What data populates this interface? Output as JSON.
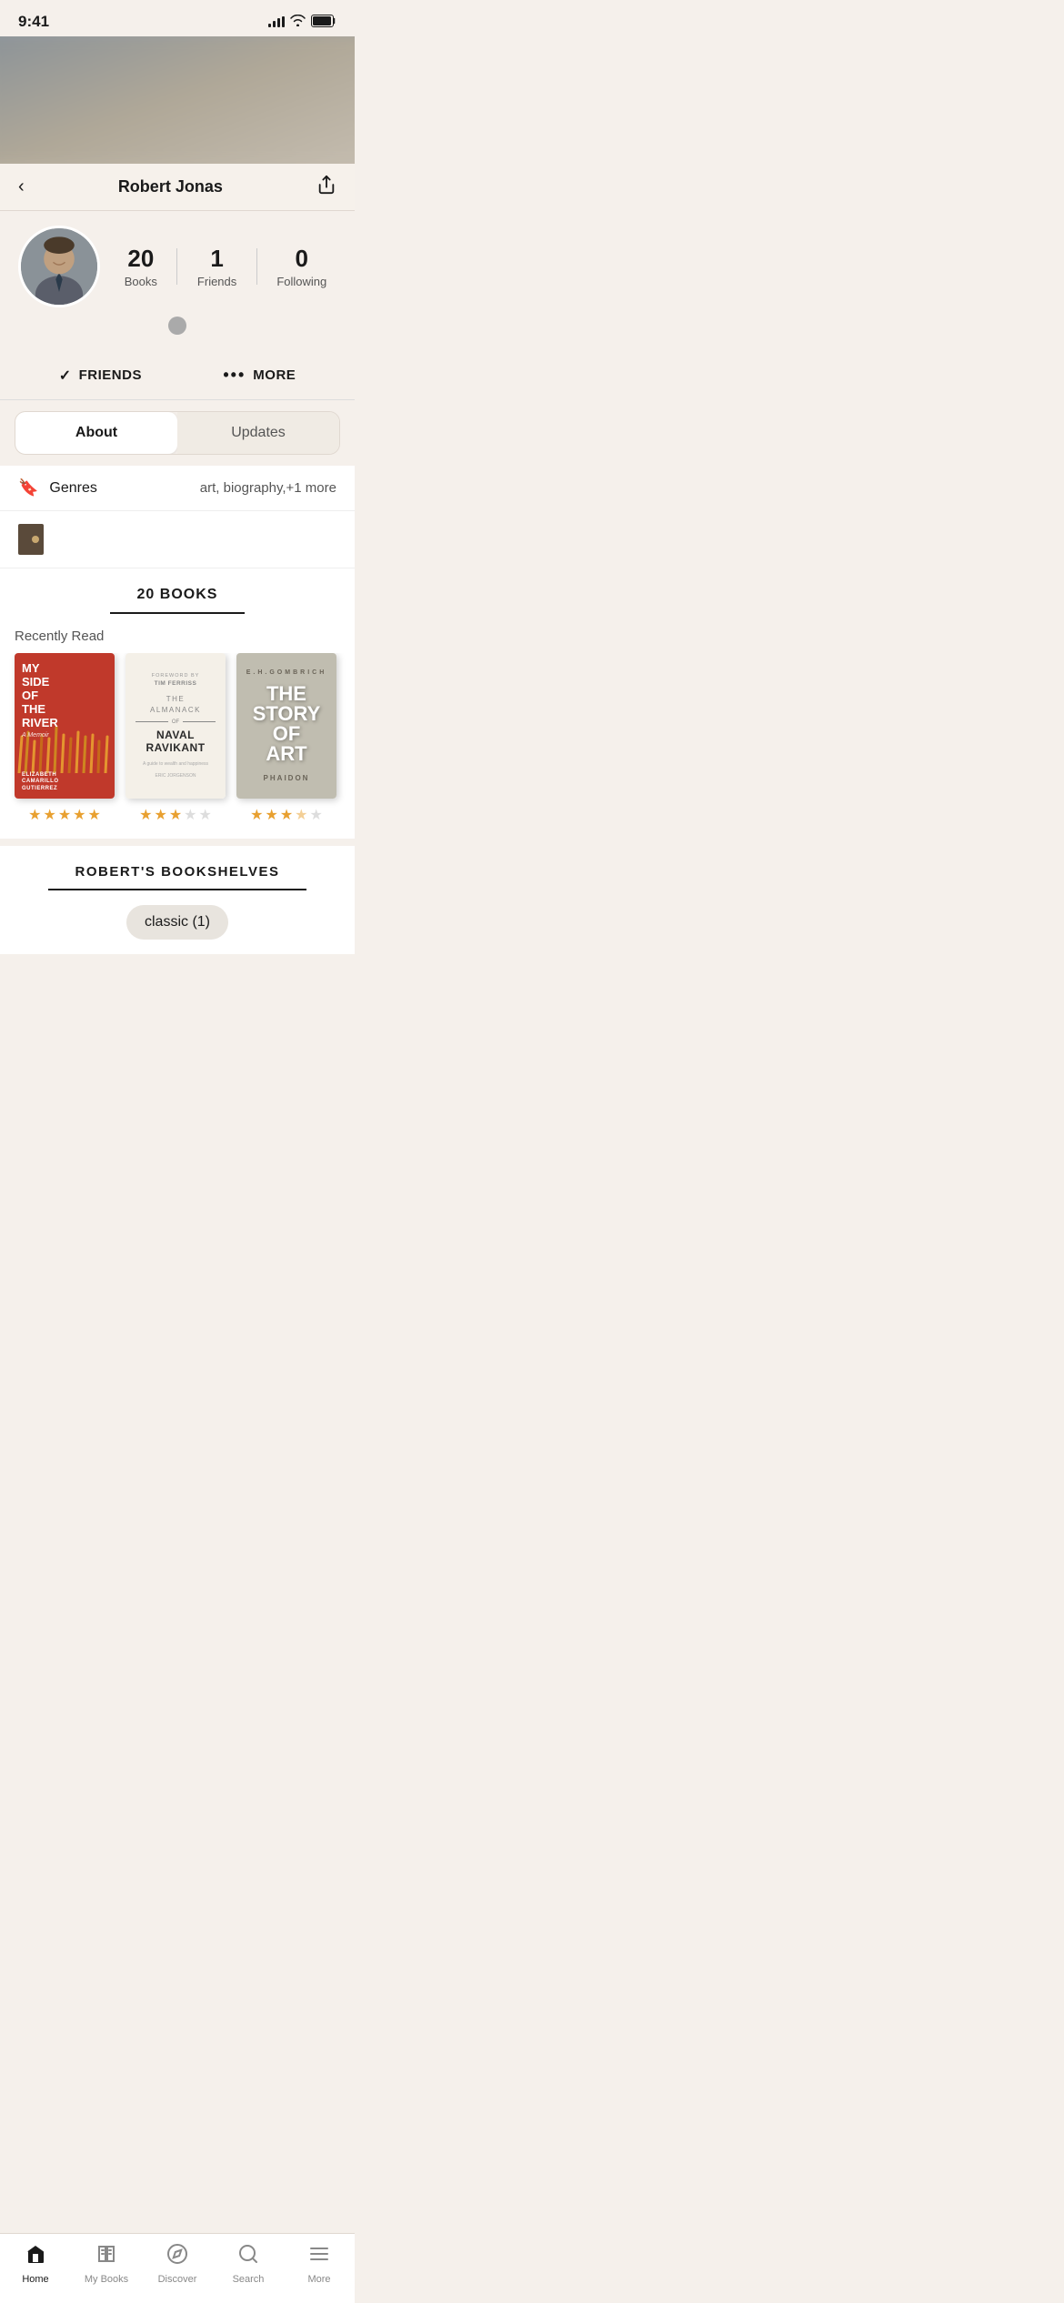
{
  "statusBar": {
    "time": "9:41"
  },
  "nav": {
    "title": "Robert Jonas",
    "backLabel": "‹",
    "shareLabel": "⬆"
  },
  "profile": {
    "stats": {
      "books": {
        "count": "20",
        "label": "Books"
      },
      "friends": {
        "count": "1",
        "label": "Friends"
      },
      "following": {
        "count": "0",
        "label": "Following"
      }
    },
    "actionButtons": {
      "friends": "FRIENDS",
      "more": "MORE"
    }
  },
  "tabs": {
    "about": "About",
    "updates": "Updates"
  },
  "genres": {
    "label": "Genres",
    "values": "art, biography,+1 more"
  },
  "booksSection": {
    "header": "20 BOOKS",
    "recentlyRead": "Recently Read",
    "books": [
      {
        "id": "1",
        "title": "MY SIDE OF THE RIVER",
        "subtitle": "A Memoir",
        "author": "ELIZABETH CAMARILLO GUTIERREZ",
        "stars": [
          5,
          5,
          5,
          5,
          5
        ],
        "type": "river"
      },
      {
        "id": "2",
        "title": "THE ALMANACK OF NAVAL RAVIKANT",
        "foreword": "Foreword by TIM FERRISS",
        "subtitle": "A guide to wealth and happiness",
        "author": "ERIC JORGENSON",
        "stars": [
          5,
          5,
          5,
          0,
          0
        ],
        "type": "almanack"
      },
      {
        "id": "3",
        "title": "THE STORY OF ART",
        "authorInitials": "E.H.GOMBRICH",
        "publisher": "PHAIDON",
        "stars": [
          5,
          5,
          5,
          0.5,
          0
        ],
        "type": "story-of-art"
      }
    ]
  },
  "bookshelves": {
    "header": "ROBERT'S BOOKSHELVES",
    "tags": [
      {
        "label": "classic (1)"
      }
    ]
  },
  "bottomNav": {
    "items": [
      {
        "id": "home",
        "label": "Home",
        "icon": "🏠",
        "active": true
      },
      {
        "id": "mybooks",
        "label": "My Books",
        "icon": "📖",
        "active": false
      },
      {
        "id": "discover",
        "label": "Discover",
        "icon": "🧭",
        "active": false
      },
      {
        "id": "search",
        "label": "Search",
        "icon": "🔍",
        "active": false
      },
      {
        "id": "more",
        "label": "More",
        "icon": "≡",
        "active": false
      }
    ]
  }
}
